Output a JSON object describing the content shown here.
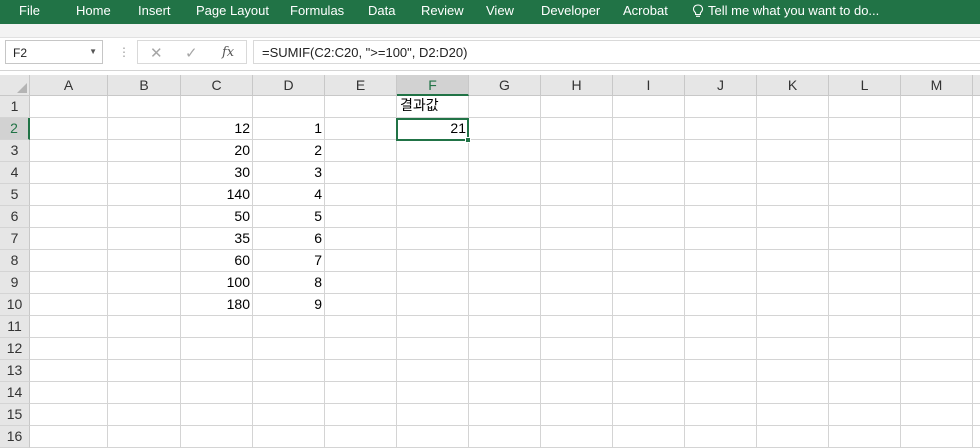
{
  "ribbon": {
    "tabs": [
      "File",
      "Home",
      "Insert",
      "Page Layout",
      "Formulas",
      "Data",
      "Review",
      "View",
      "Developer",
      "Acrobat"
    ],
    "tell_me": "Tell me what you want to do...",
    "icon": "lightbulb-icon",
    "color": "#217346"
  },
  "formula_bar": {
    "name_box": "F2",
    "cancel_icon": "cancel-x-icon",
    "enter_icon": "check-icon",
    "fx_label": "fx",
    "formula": "=SUMIF(C2:C20, \">=100\", D2:D20)"
  },
  "grid": {
    "columns": [
      "A",
      "B",
      "C",
      "D",
      "E",
      "F",
      "G",
      "H",
      "I",
      "J",
      "K",
      "L",
      "M"
    ],
    "selected_column": "F",
    "selected_row": "2",
    "rows": [
      "1",
      "2",
      "3",
      "4",
      "5",
      "6",
      "7",
      "8",
      "9",
      "10",
      "11",
      "12",
      "13",
      "14",
      "15",
      "16"
    ],
    "cells": {
      "F1": "결과값",
      "F2": "21",
      "C2": "12",
      "C3": "20",
      "C4": "30",
      "C5": "140",
      "C6": "50",
      "C7": "35",
      "C8": "60",
      "C9": "100",
      "C10": "180",
      "D2": "1",
      "D3": "2",
      "D4": "3",
      "D5": "4",
      "D6": "5",
      "D7": "6",
      "D8": "7",
      "D9": "8",
      "D10": "9"
    }
  }
}
